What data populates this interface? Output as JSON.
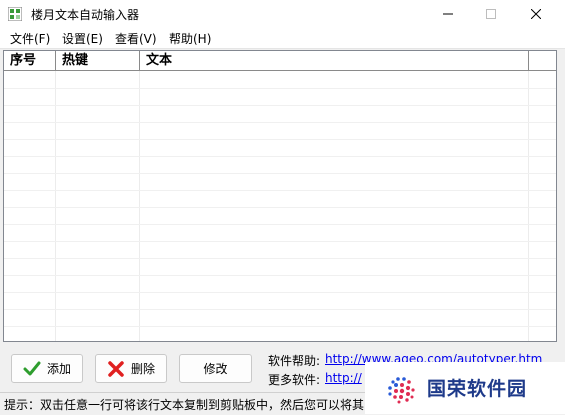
{
  "window": {
    "title": "楼月文本自动输入器"
  },
  "menu": [
    "文件(F)",
    "设置(E)",
    "查看(V)",
    "帮助(H)"
  ],
  "list": {
    "columns": [
      "序号",
      "热键",
      "文本"
    ],
    "rows": []
  },
  "buttons": {
    "add": "添加",
    "delete": "删除",
    "edit": "修改"
  },
  "info": {
    "help_label": "软件帮助:",
    "help_link": "http://www.aqeo.com/autotyper.htm",
    "more_label": "更多软件:",
    "more_link": "http://"
  },
  "status": {
    "text": "提示：双击任意一行可将该行文本复制到剪贴板中，然后您可以将其"
  },
  "watermark": {
    "text": "国荣软件园"
  },
  "colors": {
    "link": "#0000ee",
    "watermark": "#1e3a8a",
    "add_icon": "#2e9d2e",
    "delete_icon": "#e02020"
  }
}
